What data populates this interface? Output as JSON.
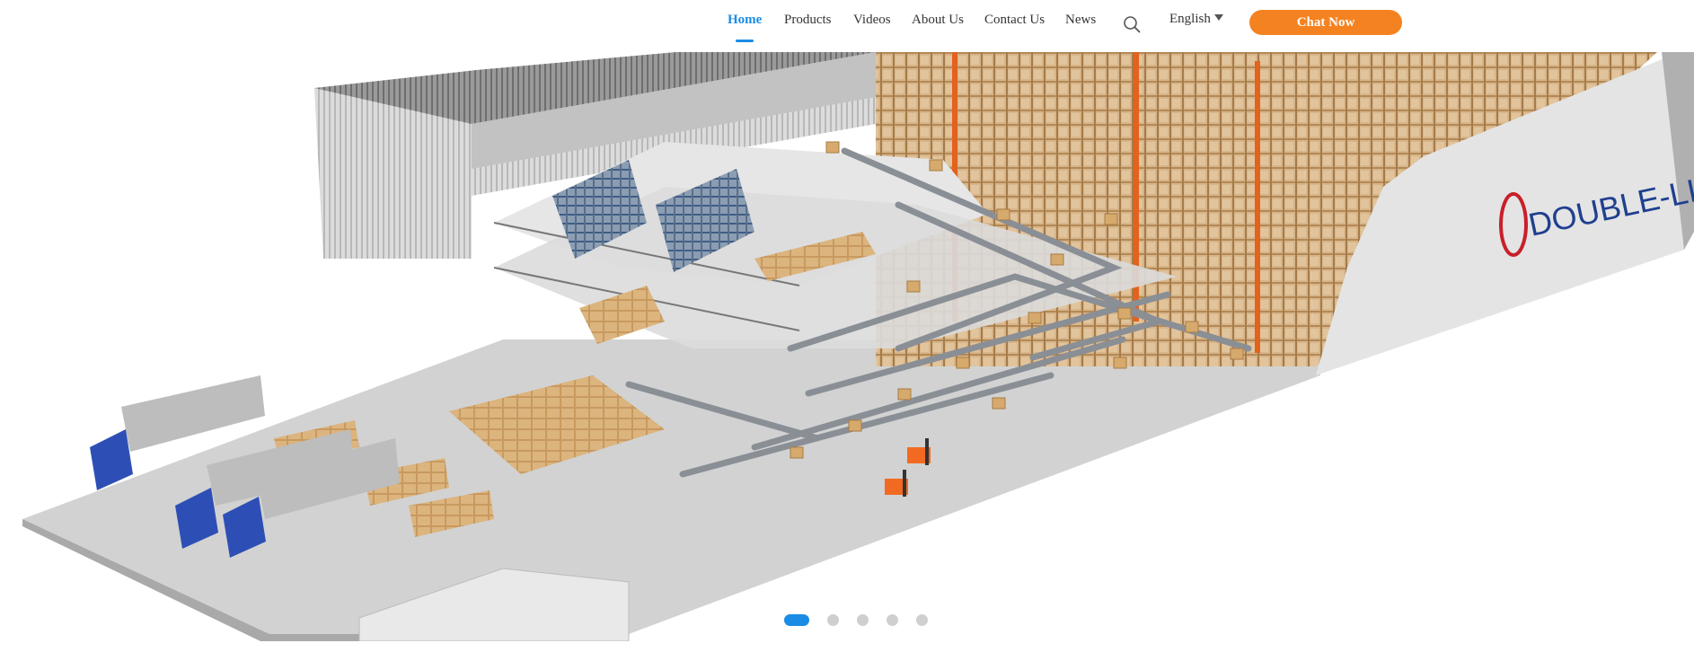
{
  "nav": {
    "items": [
      {
        "label": "Home",
        "active": true
      },
      {
        "label": "Products"
      },
      {
        "label": "Videos"
      },
      {
        "label": "About Us"
      },
      {
        "label": "Contact Us"
      },
      {
        "label": "News"
      }
    ],
    "search_icon": "search-icon",
    "language": "English",
    "chat_button": "Chat Now"
  },
  "hero": {
    "brand_text": "DOUBLE-LIN",
    "slides_total": 5,
    "active_slide": 1
  },
  "colors": {
    "accent_blue": "#1a8ce6",
    "chat_orange": "#f58220",
    "rack_orange": "#e2621e",
    "brand_red": "#c8202a",
    "truck_blue": "#2d4fb5"
  }
}
